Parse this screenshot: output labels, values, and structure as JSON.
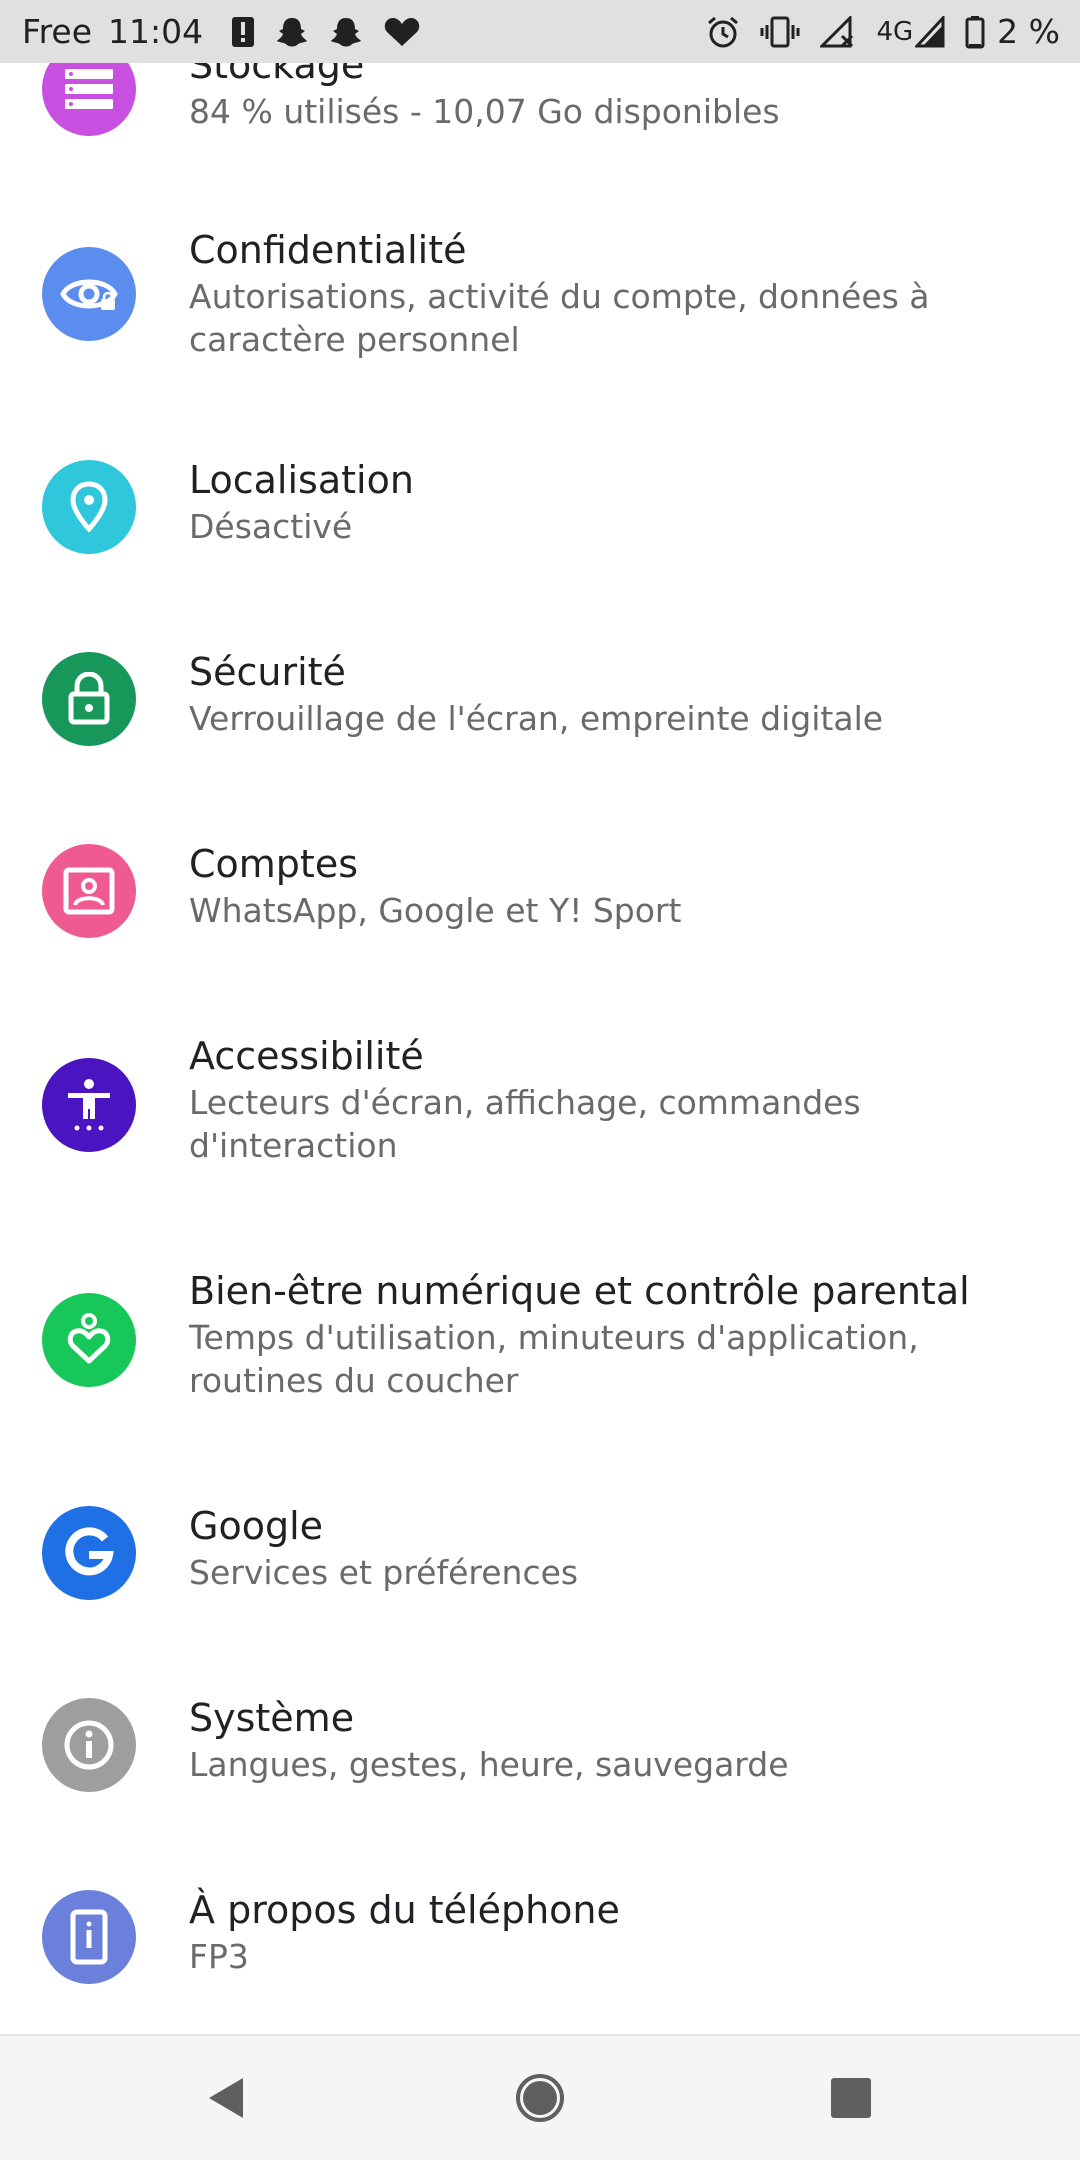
{
  "status_bar": {
    "carrier": "Free",
    "time": "11:04",
    "network": "4G",
    "battery_pct": "2 %",
    "left_icons": [
      "alert-icon",
      "snapchat-ghost-icon",
      "snapchat-ghost-icon",
      "heart-icon"
    ],
    "right_icons": [
      "alarm-icon",
      "vibrate-icon",
      "no-signal-icon",
      "4g-signal-icon",
      "battery-icon"
    ]
  },
  "settings": [
    {
      "title": "Stockage",
      "subtitle": "84 % utilisés - 10,07 Go disponibles",
      "icon": "storage-icon",
      "color": "#c850e0"
    },
    {
      "title": "Confidentialité",
      "subtitle": "Autorisations, activité du compte, données à caractère personnel",
      "icon": "privacy-eye-icon",
      "color": "#5b8def"
    },
    {
      "title": "Localisation",
      "subtitle": "Désactivé",
      "icon": "location-pin-icon",
      "color": "#2ec7dc"
    },
    {
      "title": "Sécurité",
      "subtitle": "Verrouillage de l'écran, empreinte digitale",
      "icon": "lock-icon",
      "color": "#17975a"
    },
    {
      "title": "Comptes",
      "subtitle": "WhatsApp, Google et Y! Sport",
      "icon": "account-icon",
      "color": "#ef5b91"
    },
    {
      "title": "Accessibilité",
      "subtitle": "Lecteurs d'écran, affichage, commandes d'interaction",
      "icon": "accessibility-icon",
      "color": "#4a14c0"
    },
    {
      "title": "Bien-être numérique et contrôle parental",
      "subtitle": "Temps d'utilisation, minuteurs d'application, routines du coucher",
      "icon": "wellbeing-heart-icon",
      "color": "#18c75a"
    },
    {
      "title": "Google",
      "subtitle": "Services et préférences",
      "icon": "google-icon",
      "color": "#1f6fe5"
    },
    {
      "title": "Système",
      "subtitle": "Langues, gestes, heure, sauvegarde",
      "icon": "info-icon",
      "color": "#9e9e9e"
    },
    {
      "title": "À propos du téléphone",
      "subtitle": "FP3",
      "icon": "phone-icon",
      "color": "#6b80da"
    }
  ],
  "nav_bar": {
    "buttons": [
      "back-icon",
      "home-icon",
      "recents-icon"
    ]
  }
}
